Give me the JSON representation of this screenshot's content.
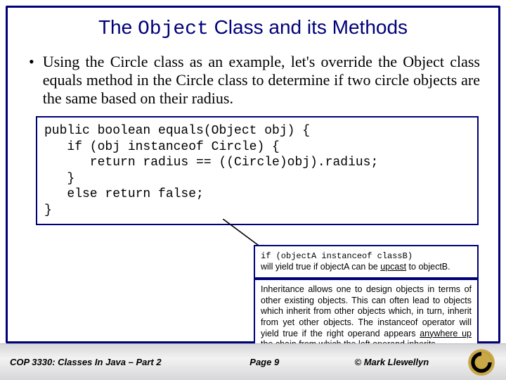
{
  "title": {
    "pre": "The ",
    "mono": "Object",
    "post": " Class and its Methods"
  },
  "bullet": "Using the Circle class as an example, let's override the Object class equals method in the Circle class to determine if two circle objects are the same based on their radius.",
  "code": "public boolean equals(Object obj) {\n   if (obj instanceof Circle) {\n      return radius == ((Circle)obj).radius;\n   }\n   else return false;\n}",
  "sidebox1": {
    "line1_mono": "if (objectA instanceof classB)",
    "line2a": "will yield true if objectA can be ",
    "line2b_ul": "upcast",
    "line2c": " to objectB."
  },
  "sidebox2": {
    "t1": "Inheritance allows one to design objects in terms of other existing objects.  This can often lead to objects which inherit from other objects which, in turn, inherit from yet other objects.  The instanceof operator will yield true if the right operand appears ",
    "t_ul": "anywhere up",
    "t2": " the chain from which the left operand inherits."
  },
  "footer": {
    "left": "COP 3330:  Classes In Java – Part 2",
    "center": "Page 9",
    "right": "© Mark Llewellyn"
  }
}
